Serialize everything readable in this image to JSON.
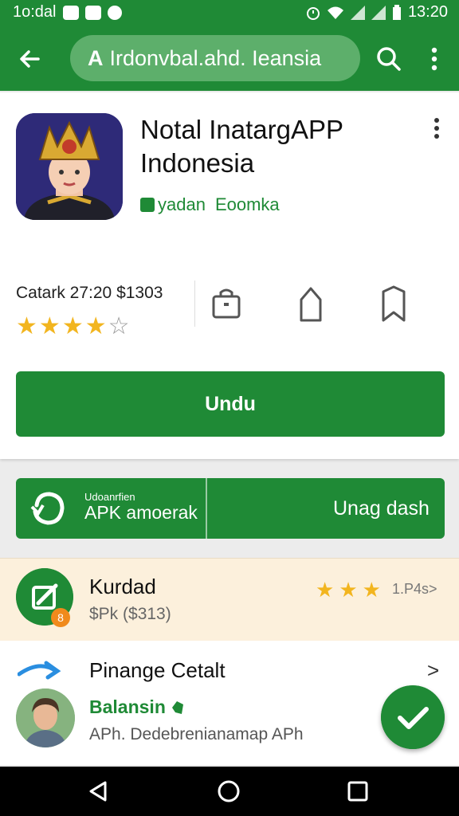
{
  "status_bar": {
    "carrier": "1o:dal",
    "time": "13:20"
  },
  "app_bar": {
    "search_badge": "A",
    "search_text": "Irdonvbal.ahd. Ieansia"
  },
  "app": {
    "title": "Notal InatargAPP Indonesia",
    "developer": "yadan",
    "category": "Eoomka",
    "meta": "Catark 27:20 $1303",
    "rating": 4,
    "rating_max": 5,
    "install_label": "Undu"
  },
  "banner": {
    "small_text": "Udoanrfien",
    "label": "APK amoerak",
    "button_label": "Unag dash"
  },
  "list": {
    "item1": {
      "title": "Kurdad",
      "subtitle": "$Pk ($313)",
      "badge": "8",
      "rating": 3,
      "rating_text": "1.P4s>"
    },
    "item2": {
      "title": "Pinange Cetalt",
      "chevron": ">",
      "developer": "Balansin",
      "subtitle": "APh. Dedebrenianamap APh"
    }
  },
  "colors": {
    "primary": "#1f8a36",
    "star": "#f2b51f",
    "highlight_row": "#fcf0dc",
    "badge": "#f08a1c"
  },
  "icons": [
    "back-arrow-icon",
    "search-icon",
    "more-vert-icon",
    "bag-icon",
    "share-icon",
    "bookmark-icon",
    "check-icon",
    "home-icon",
    "recents-icon"
  ]
}
